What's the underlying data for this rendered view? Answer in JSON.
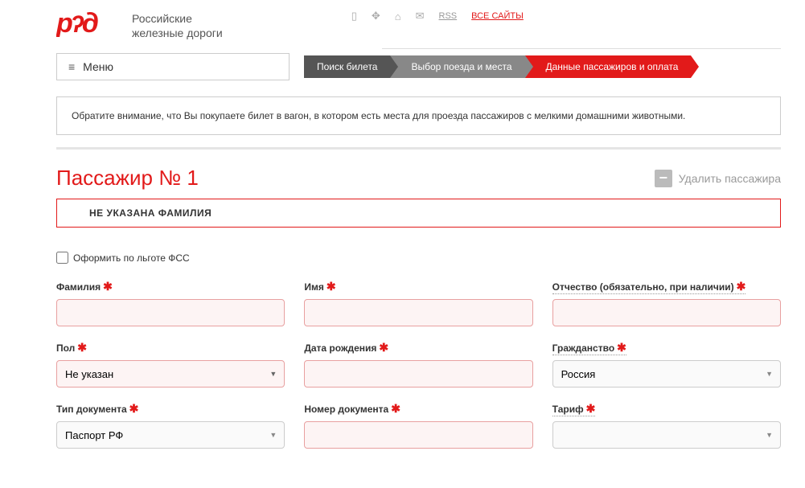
{
  "header": {
    "logo_text_line1": "Российские",
    "logo_text_line2": "железные дороги",
    "top_links": {
      "rss": "RSS",
      "all_sites": "ВСЕ САЙТЫ"
    }
  },
  "nav": {
    "menu_label": "Меню",
    "steps": {
      "step1": "Поиск билета",
      "step2": "Выбор поезда и места",
      "step3": "Данные пассажиров и оплата"
    }
  },
  "notice": "Обратите внимание, что Вы покупаете билет в вагон, в котором есть места для проезда пассажиров с мелкими домашними животными.",
  "passenger": {
    "title": "Пассажир № 1",
    "delete_label": "Удалить пассажира",
    "error": "НЕ УКАЗАНА ФАМИЛИЯ",
    "fss_checkbox": "Оформить по льготе ФСС"
  },
  "form": {
    "surname_label": "Фамилия",
    "name_label": "Имя",
    "patronymic_label": "Отчество (обязательно, при наличии)",
    "gender_label": "Пол",
    "gender_value": "Не указан",
    "birthdate_label": "Дата рождения",
    "citizenship_label": "Гражданство",
    "citizenship_value": "Россия",
    "doctype_label": "Тип документа",
    "doctype_value": "Паспорт РФ",
    "docnum_label": "Номер документа",
    "tariff_label": "Тариф",
    "tariff_value": ""
  }
}
